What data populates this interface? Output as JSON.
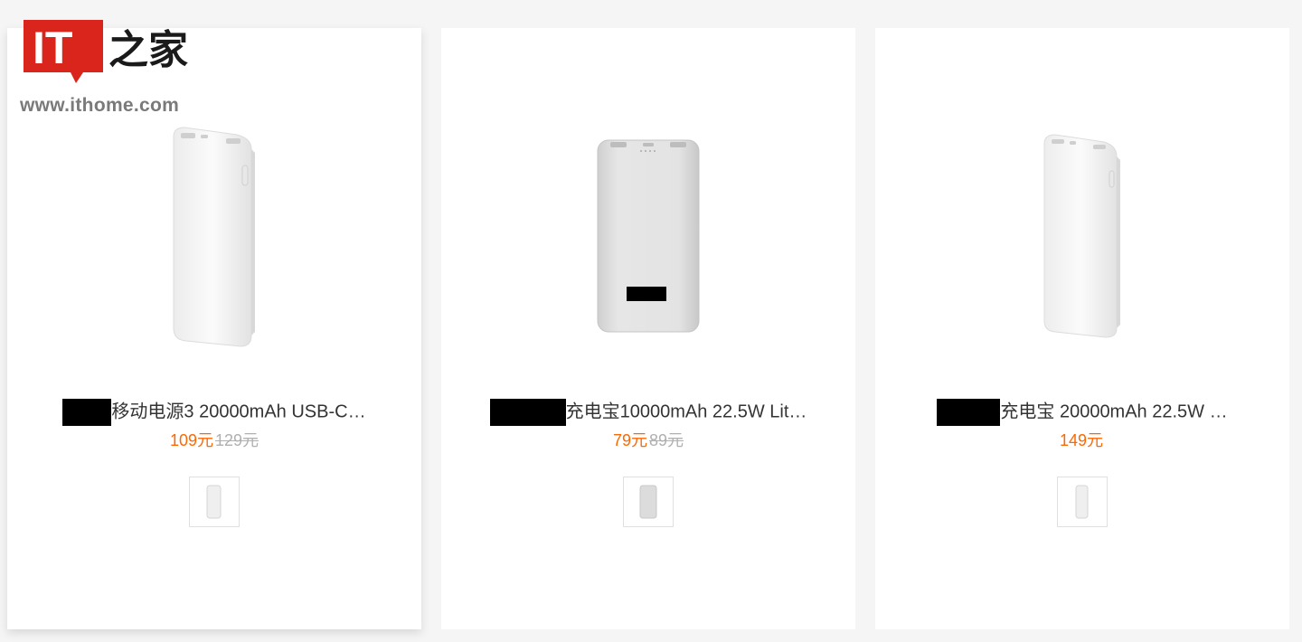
{
  "logo": {
    "text_it": "IT",
    "text_cn": "之家",
    "url": "www.ithome.com",
    "brand_color": "#d9251c"
  },
  "accent": {
    "price_color": "#ff6700",
    "old_price_color": "#b0b0b0"
  },
  "products": [
    {
      "title_suffix": "移动电源3 20000mAh USB-C…",
      "price": "109元",
      "old_price": "129元",
      "icon": "power-bank-icon"
    },
    {
      "title_suffix": "充电宝10000mAh 22.5W Lit…",
      "price": "79元",
      "old_price": "89元",
      "icon": "power-bank-icon"
    },
    {
      "title_suffix": "充电宝 20000mAh 22.5W …",
      "price": "149元",
      "old_price": "",
      "icon": "power-bank-icon"
    }
  ]
}
